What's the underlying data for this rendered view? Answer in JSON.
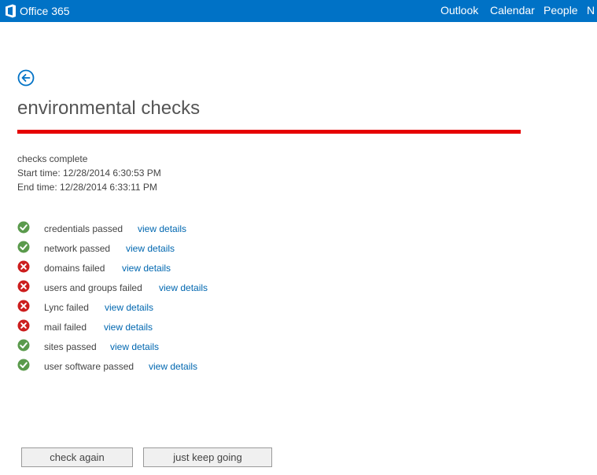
{
  "header": {
    "brand": "Office 365",
    "nav": [
      {
        "label": "Outlook",
        "name": "nav-outlook"
      },
      {
        "label": "Calendar",
        "name": "nav-calendar"
      },
      {
        "label": "People",
        "name": "nav-people"
      },
      {
        "label": "N",
        "name": "nav-more"
      }
    ]
  },
  "page": {
    "title": "environmental checks",
    "progress_percent": 100,
    "progress_color": "#e60000",
    "status": "checks complete",
    "start_time": "Start time: 12/28/2014 6:30:53 PM",
    "end_time": "End time: 12/28/2014 6:33:11 PM"
  },
  "checks": [
    {
      "label": "credentials passed",
      "status": "passed",
      "icon": "check-icon",
      "link": "view details"
    },
    {
      "label": "network passed",
      "status": "passed",
      "icon": "check-icon",
      "link": "view details"
    },
    {
      "label": "domains failed",
      "status": "failed",
      "icon": "error-icon",
      "link": "view details"
    },
    {
      "label": "users and groups failed",
      "status": "failed",
      "icon": "error-icon",
      "link": "view details"
    },
    {
      "label": "Lync failed",
      "status": "failed",
      "icon": "error-icon",
      "link": "view details"
    },
    {
      "label": "mail failed",
      "status": "failed",
      "icon": "error-icon",
      "link": "view details"
    },
    {
      "label": "sites passed",
      "status": "passed",
      "icon": "check-icon",
      "link": "view details"
    },
    {
      "label": "user software passed",
      "status": "passed",
      "icon": "check-icon",
      "link": "view details"
    }
  ],
  "buttons": {
    "check_again": "check again",
    "keep_going": "just keep going"
  },
  "colors": {
    "header": "#0072c6",
    "passed": "#5a9a4c",
    "failed": "#cc1e1e",
    "link": "#0067b0"
  }
}
